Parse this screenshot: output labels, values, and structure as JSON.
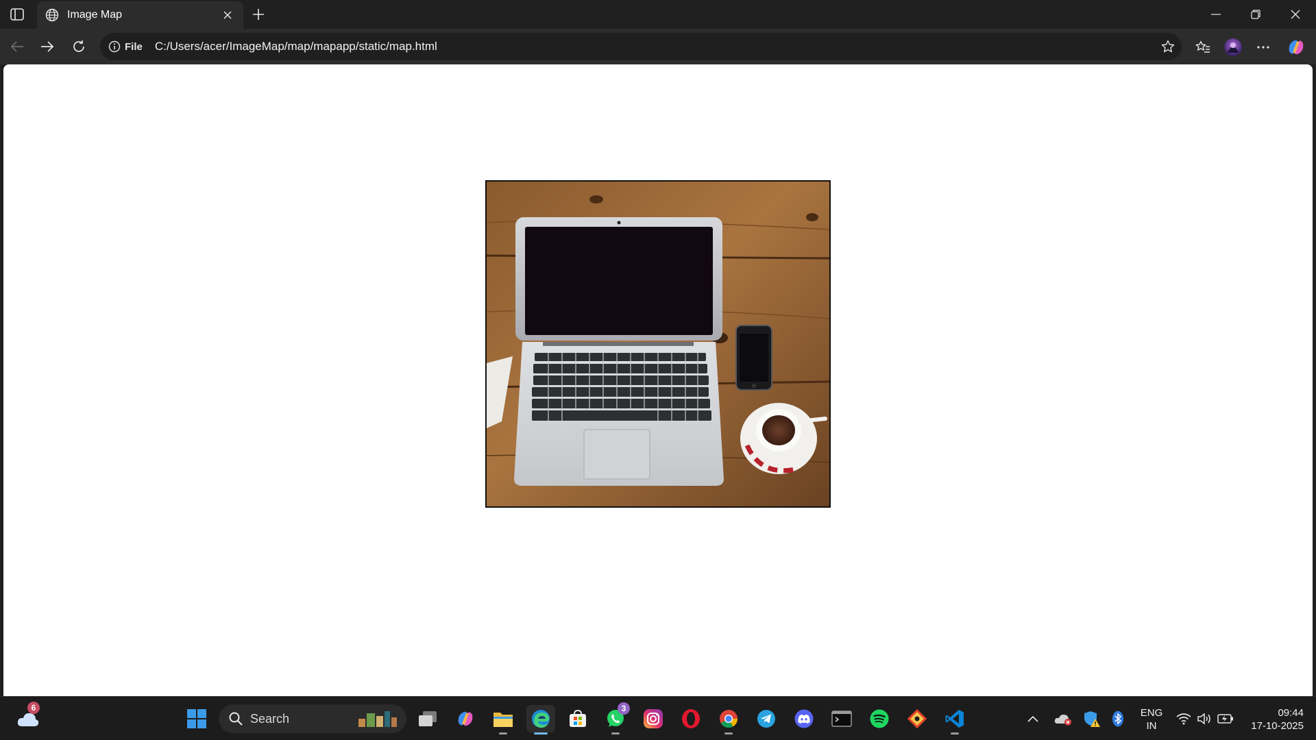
{
  "browser": {
    "tab": {
      "title": "Image Map"
    },
    "address": {
      "scheme_label": "File",
      "url": "C:/Users/acer/ImageMap/map/mapapp/static/map.html"
    }
  },
  "page": {
    "image": {
      "subject": "laptop-phone-coffee-on-wooden-desk"
    }
  },
  "taskbar": {
    "weather_badge": "6",
    "search_label": "Search",
    "whatsapp_badge": "3",
    "language": {
      "line1": "ENG",
      "line2": "IN"
    },
    "clock": {
      "time": "09:44",
      "date": "17-10-2025"
    }
  },
  "colors": {
    "tab_active": "#2c2c2c",
    "chrome_bg": "#202020",
    "accent": "#76b9ed"
  }
}
